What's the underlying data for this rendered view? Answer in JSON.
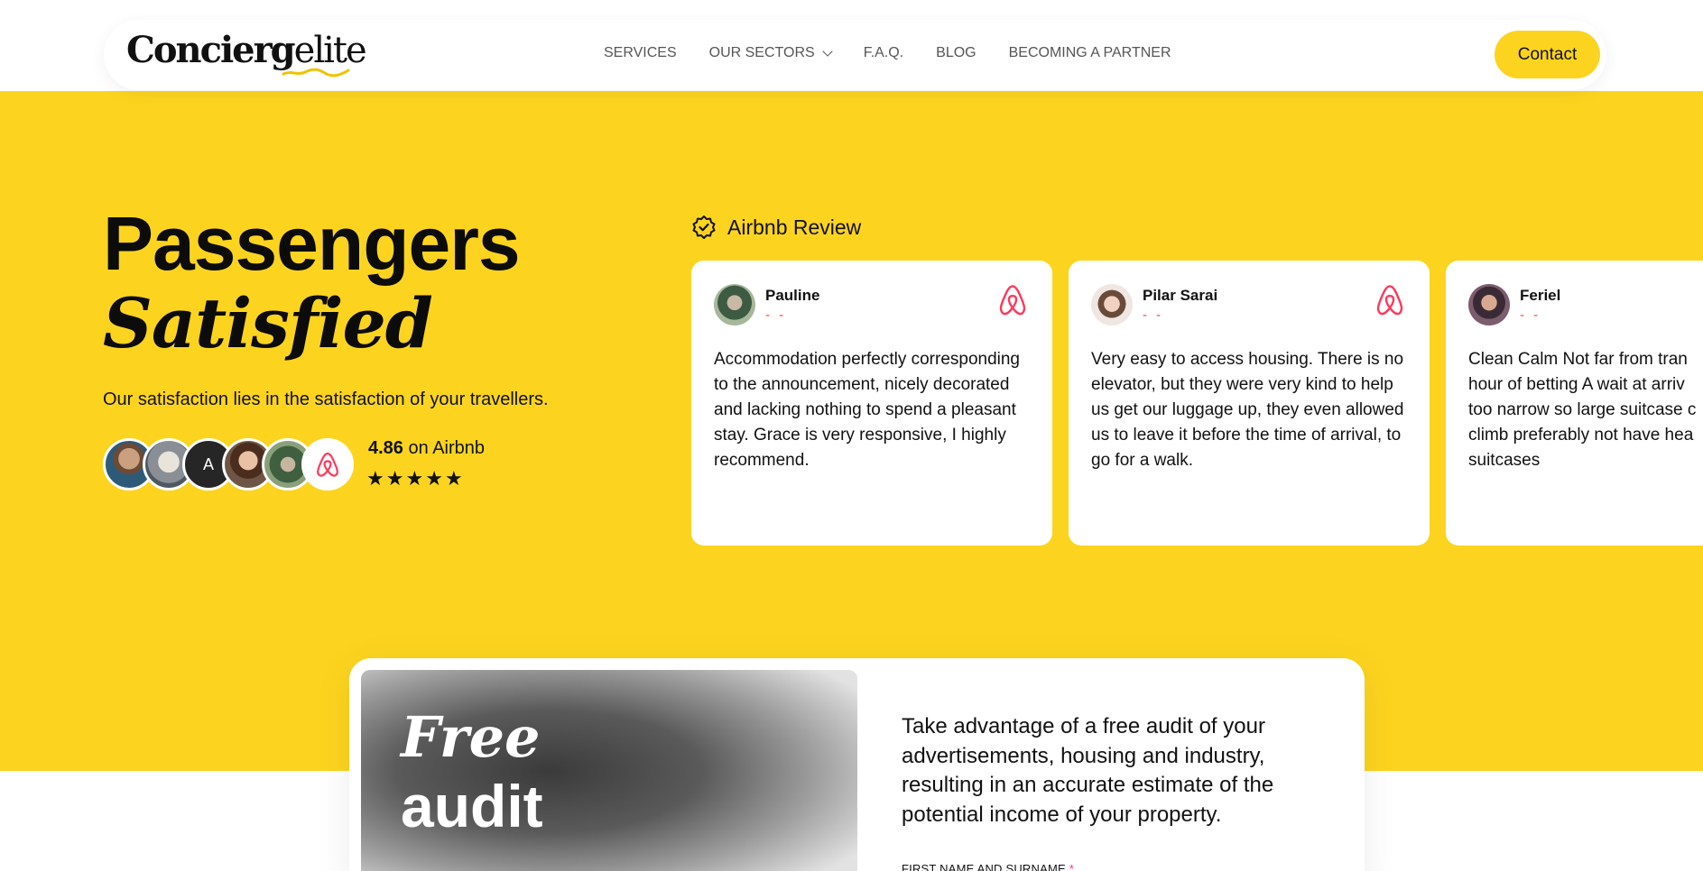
{
  "header": {
    "logo_text_bold": "Concierg",
    "logo_text_thin": "elite",
    "nav": [
      {
        "label": "SERVICES"
      },
      {
        "label": "OUR SECTORS",
        "has_dropdown": true
      },
      {
        "label": "F.A.Q."
      },
      {
        "label": "BLOG"
      },
      {
        "label": "BECOMING A PARTNER"
      }
    ],
    "contact_label": "Contact"
  },
  "hero": {
    "title_line1": "Passengers",
    "title_line2": "Satisfied",
    "subtitle": "Our satisfaction lies in the satisfaction of your travellers.",
    "avatar_initial": "A",
    "rating_value": "4.86",
    "rating_suffix": " on Airbnb",
    "stars": 5
  },
  "reviews": {
    "heading": "Airbnb Review",
    "cards": [
      {
        "name": "Pauline",
        "dash": "- -",
        "text": "Accommodation perfectly corresponding to the announcement, nicely decorated and lacking nothing to spend a pleasant stay. Grace is very responsive, I highly recommend."
      },
      {
        "name": "Pilar Sarai",
        "dash": "- -",
        "text": "Very easy to access housing. There is no elevator, but they were very kind to help us get our luggage up, they even allowed us to leave it before the time of arrival, to go for a walk."
      },
      {
        "name": "Feriel",
        "dash": "- -",
        "lines": [
          "Clean Calm Not far from tran",
          "hour of betting A wait at arriv",
          "too narrow so large suitcase c",
          "climb preferably not have hea",
          "suitcases"
        ]
      }
    ]
  },
  "audit": {
    "title_italic": "Free",
    "title_word": "audit",
    "description": "Take advantage of a free audit of your advertisements, housing and industry, resulting in an accurate estimate of the potential income of your property.",
    "field_label": "FIRST NAME AND SURNAME",
    "required_mark": "*"
  },
  "colors": {
    "accent_yellow": "#fcd41f",
    "airbnb_red": "#ff385c"
  }
}
